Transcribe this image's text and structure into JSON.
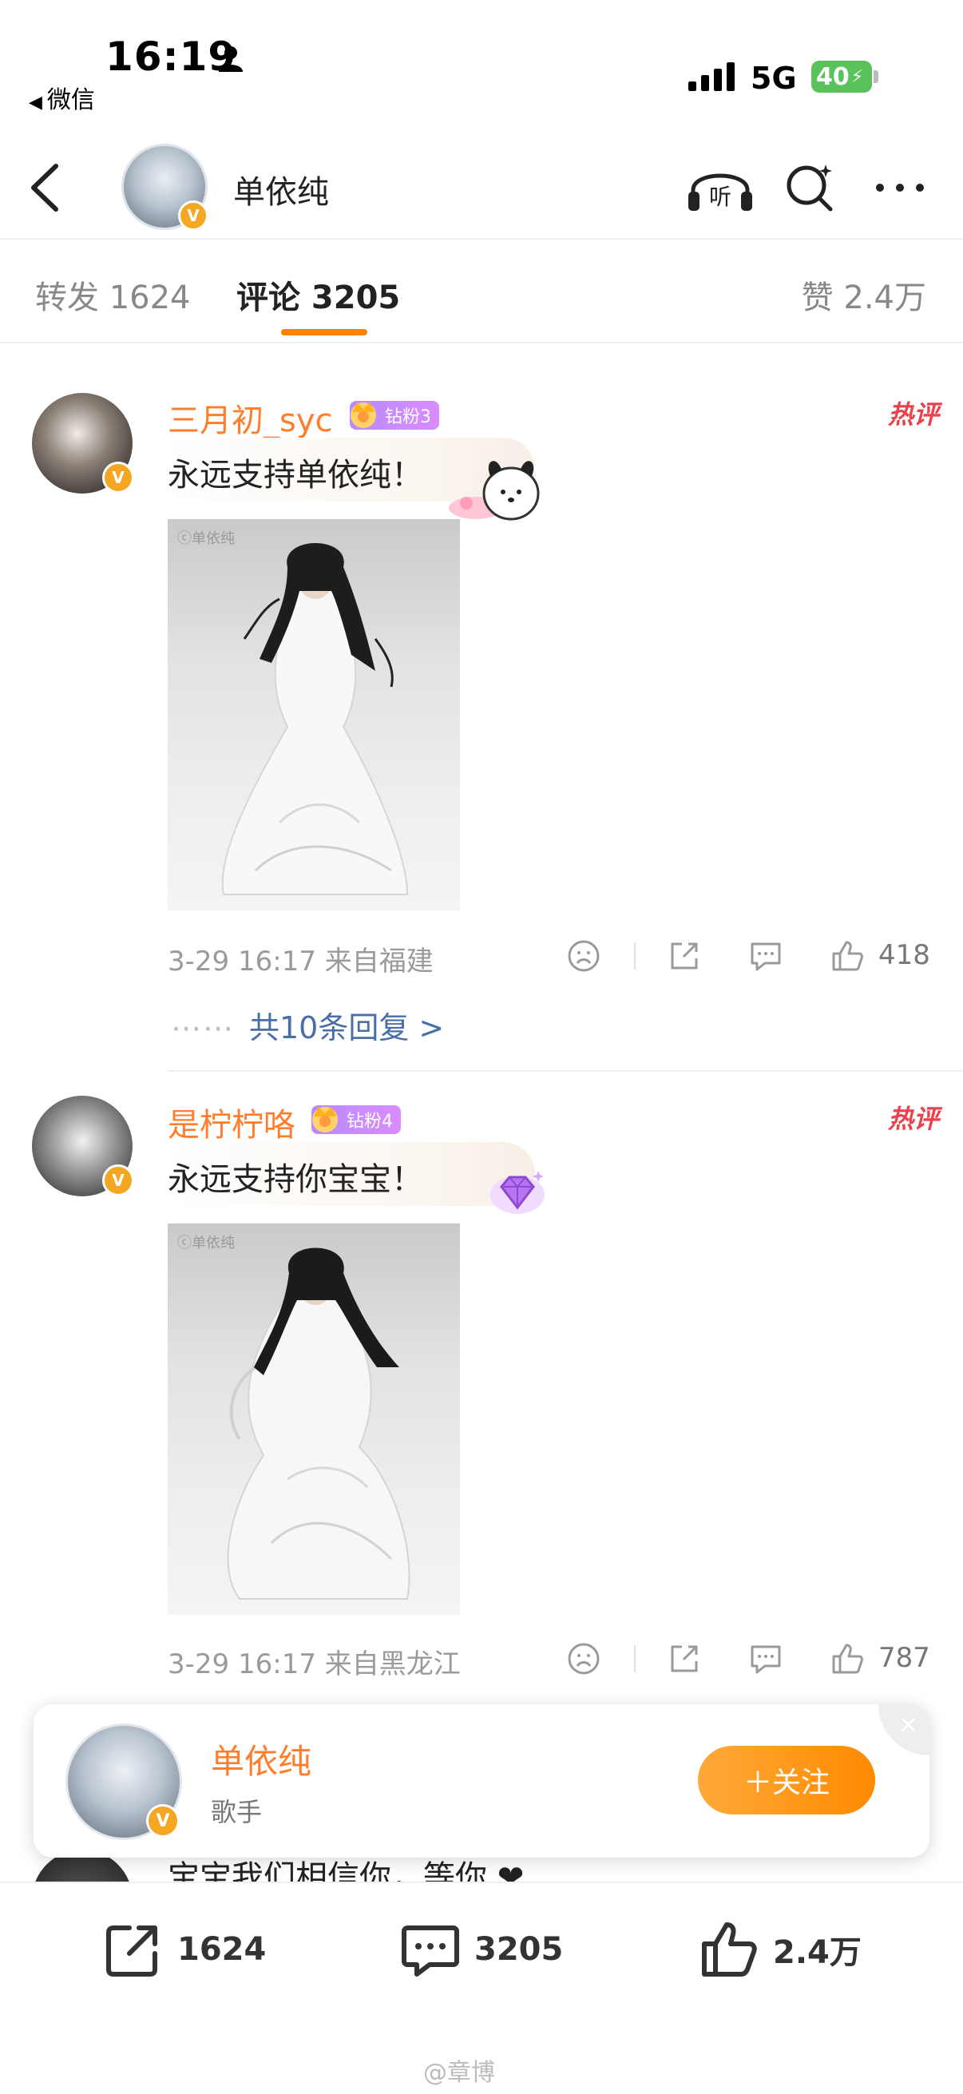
{
  "status_bar": {
    "time": "16:19",
    "back_app": "微信",
    "network": "5G",
    "battery": "40"
  },
  "nav": {
    "title": "单依纯"
  },
  "tabs": {
    "repost": "转发 1624",
    "comment": "评论 3205",
    "like": "赞 2.4万"
  },
  "comments": [
    {
      "name": "三月初_syc",
      "fan_level": "钻粉3",
      "hot_tag": "热评",
      "text": "永远支持单依纯！",
      "photo_watermark": "ⓒ单依纯",
      "meta": "3-29 16:17  来自福建",
      "likes": "418",
      "replies": "共10条回复 >"
    },
    {
      "name": "是柠柠咯",
      "fan_level": "钻粉4",
      "hot_tag": "热评",
      "text": "永远支持你宝宝！",
      "photo_watermark": "ⓒ单依纯",
      "meta": "3-29 16:17  来自黑龙江",
      "likes": "787"
    }
  ],
  "peek_comment": {
    "text": "宝宝我们相信你，等你 ❤"
  },
  "follow_card": {
    "name": "单依纯",
    "subtitle": "歌手",
    "follow_label": "＋关注",
    "close": "×"
  },
  "toolbar": {
    "repost_count": "1624",
    "comment_count": "3205",
    "like_count": "2.4万"
  },
  "watermark": "@章博",
  "colors": {
    "accent": "#ff8200",
    "username": "#ff7e2d",
    "hot": "#e8424c",
    "link": "#4a6ea8",
    "verified": "#f5a623"
  }
}
